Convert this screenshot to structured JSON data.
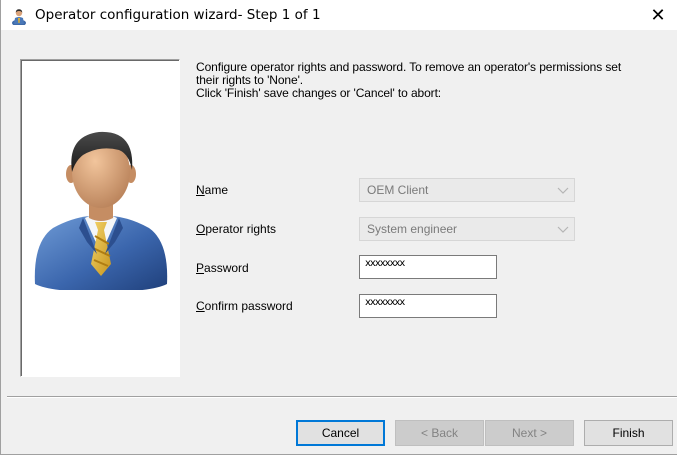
{
  "window": {
    "title": "Operator configuration wizard- Step 1 of 1",
    "close_glyph": "✕"
  },
  "intro": {
    "line1": "Configure operator rights and password. To remove an operator's permissions set",
    "line2": "their rights to 'None'.",
    "line3": "Click 'Finish' save changes or 'Cancel' to abort:"
  },
  "form": {
    "name": {
      "label_key": "N",
      "label_rest": "ame",
      "value": "OEM Client"
    },
    "rights": {
      "label_key": "O",
      "label_rest": "perator rights",
      "value": "System engineer"
    },
    "password": {
      "label_key": "P",
      "label_rest": "assword",
      "value": "xxxxxxxx"
    },
    "confirm": {
      "label_key": "C",
      "label_rest": "onfirm password",
      "value": "xxxxxxxx"
    }
  },
  "buttons": {
    "cancel": "Cancel",
    "back": "< Back",
    "next": "Next >",
    "finish": "Finish"
  },
  "icons": {
    "title_icon": "operator-avatar-icon",
    "picture": "businessman-avatar-icon",
    "combo_arrow": "chevron-down-icon"
  },
  "colors": {
    "default_button_border": "#0078d7",
    "dialog_background": "#f0f0f0"
  }
}
